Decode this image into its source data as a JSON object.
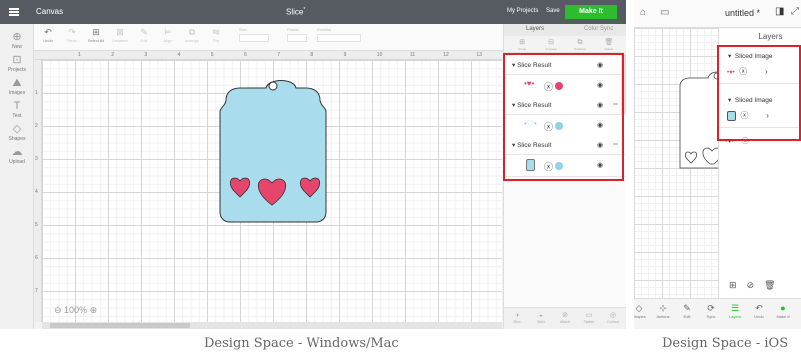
{
  "windows_mac": {
    "app_title": "Canvas",
    "doc_title": "Slice",
    "doc_title_marker": "*",
    "header": {
      "my_projects": "My Projects",
      "save": "Save",
      "make_it": "Make It"
    },
    "toolbar": [
      {
        "label": "Undo",
        "icon": "undo-icon",
        "glyph": "↶",
        "dim": false
      },
      {
        "label": "Redo",
        "icon": "redo-icon",
        "glyph": "↷",
        "dim": true
      },
      {
        "label": "Select All",
        "icon": "select-all-icon",
        "glyph": "⊞",
        "dim": false
      },
      {
        "label": "Deselect",
        "icon": "deselect-icon",
        "glyph": "⊠",
        "dim": true
      },
      {
        "label": "Edit",
        "icon": "edit-icon",
        "glyph": "✎",
        "dim": true
      },
      {
        "label": "Align",
        "icon": "align-icon",
        "glyph": "⊨",
        "dim": true
      },
      {
        "label": "Arrange",
        "icon": "arrange-icon",
        "glyph": "⧉",
        "dim": true
      },
      {
        "label": "Flip",
        "icon": "flip-icon",
        "glyph": "⇋",
        "dim": true
      }
    ],
    "toolbar_fields": {
      "size": "Size",
      "rotate": "Rotate",
      "position": "Position"
    },
    "sidebar": [
      {
        "label": "New",
        "icon": "new-icon",
        "glyph": "⊕"
      },
      {
        "label": "Projects",
        "icon": "projects-icon",
        "glyph": "⊡"
      },
      {
        "label": "Images",
        "icon": "images-icon",
        "glyph": "⛰"
      },
      {
        "label": "Text",
        "icon": "text-icon",
        "glyph": "T"
      },
      {
        "label": "Shapes",
        "icon": "shapes-icon",
        "glyph": "◇"
      },
      {
        "label": "Upload",
        "icon": "upload-icon",
        "glyph": "☁"
      }
    ],
    "ruler_top": [
      "1",
      "2",
      "3",
      "4",
      "5",
      "6",
      "7",
      "8",
      "9",
      "10",
      "11",
      "12",
      "13"
    ],
    "ruler_left": [
      "1",
      "2",
      "3",
      "4",
      "5",
      "6",
      "7"
    ],
    "zoom": "100%",
    "layers_panel": {
      "tabs": [
        "Layers",
        "Color Sync"
      ],
      "top_icons": [
        {
          "label": "Group",
          "icon": "group-icon",
          "glyph": "⊞"
        },
        {
          "label": "Ungroup",
          "icon": "ungroup-icon",
          "glyph": "⊟"
        },
        {
          "label": "Duplicate",
          "icon": "duplicate-icon",
          "glyph": "⧉"
        },
        {
          "label": "Delete",
          "icon": "delete-icon",
          "glyph": "🗑"
        }
      ],
      "groups": [
        {
          "title": "Slice Result",
          "fill_color": "#e6456c"
        },
        {
          "title": "Slice Result",
          "fill_color": "#8fd3ea"
        },
        {
          "title": "Slice Result",
          "fill_color": "#8fd3ea"
        }
      ],
      "bottom_icons": [
        {
          "label": "Slice",
          "icon": "slice-icon",
          "glyph": "◑"
        },
        {
          "label": "Weld",
          "icon": "weld-icon",
          "glyph": "◒"
        },
        {
          "label": "Attach",
          "icon": "attach-icon",
          "glyph": "⊘"
        },
        {
          "label": "Flatten",
          "icon": "flatten-icon",
          "glyph": "▭"
        },
        {
          "label": "Contour",
          "icon": "contour-icon",
          "glyph": "◎"
        }
      ]
    },
    "colors": {
      "tag_fill": "#a9dcec",
      "heart": "#e6456c",
      "highlight": "#d9222d",
      "make_it": "#2dbb2f"
    }
  },
  "ios": {
    "title": "untitled *",
    "panel_title": "Layers",
    "groups": [
      {
        "title": "Sliced Image"
      },
      {
        "title": "Sliced Image"
      }
    ],
    "bottom_bar": [
      {
        "label": "Shapes",
        "icon": "shapes-icon",
        "glyph": "◇"
      },
      {
        "label": "Actions",
        "icon": "actions-icon",
        "glyph": "⊹"
      },
      {
        "label": "Edit",
        "icon": "edit-icon",
        "glyph": "✎"
      },
      {
        "label": "Sync",
        "icon": "sync-icon",
        "glyph": "⟳"
      },
      {
        "label": "Layers",
        "icon": "layers-icon",
        "glyph": "☰"
      },
      {
        "label": "Undo",
        "icon": "undo-icon",
        "glyph": "↶"
      },
      {
        "label": "Make It",
        "icon": "make-it-icon",
        "glyph": "●"
      }
    ]
  },
  "captions": {
    "left": "Design Space - Windows/Mac",
    "right": "Design Space - iOS"
  }
}
